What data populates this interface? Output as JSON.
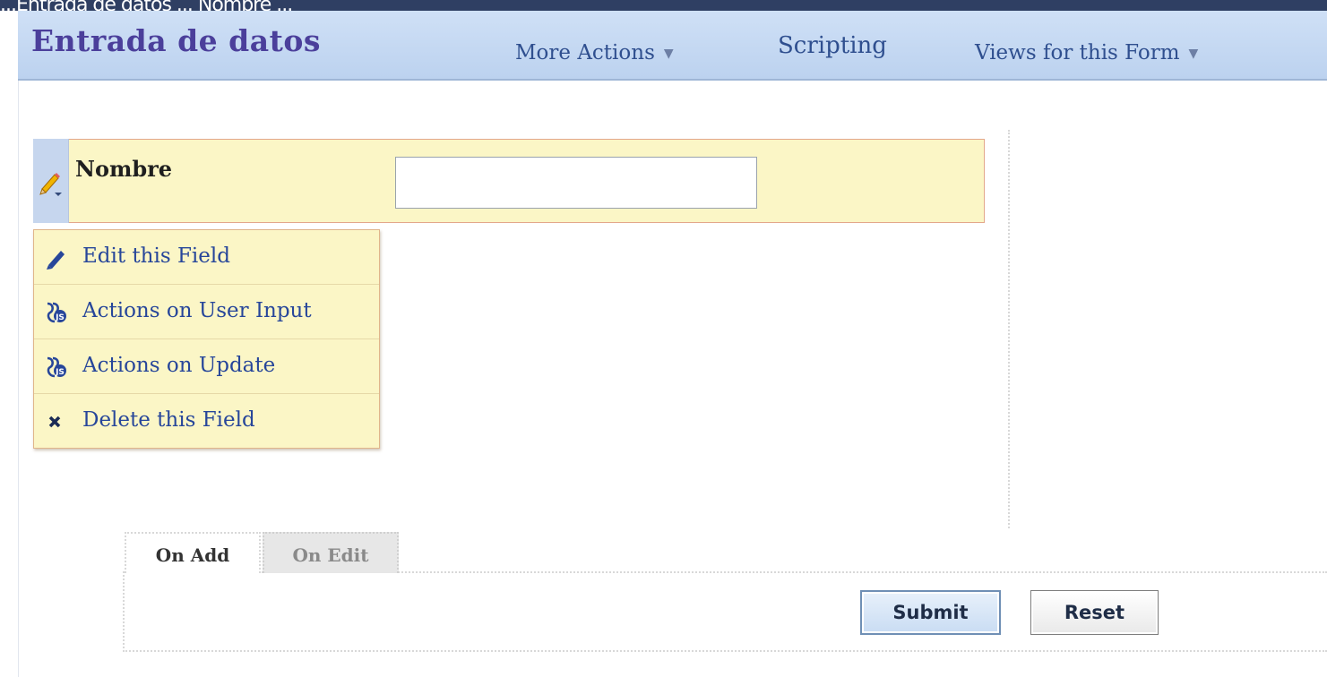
{
  "top_strip": {
    "text": "...Entrada de datos ... Nombre ..."
  },
  "header": {
    "title": "Entrada de datos",
    "menus": {
      "more_actions": "More Actions",
      "scripting": "Scripting",
      "views": "Views for this Form"
    }
  },
  "field": {
    "label": "Nombre",
    "value": ""
  },
  "context_menu": {
    "items": [
      {
        "label": "Edit this Field",
        "icon": "pencil-icon"
      },
      {
        "label": "Actions on User Input",
        "icon": "script-icon"
      },
      {
        "label": "Actions on Update",
        "icon": "script-icon"
      },
      {
        "label": "Delete this Field",
        "icon": "close-icon"
      }
    ]
  },
  "tabs": {
    "on_add": "On Add",
    "on_edit": "On Edit",
    "active": "On Add"
  },
  "buttons": {
    "submit": "Submit",
    "reset": "Reset"
  },
  "colors": {
    "header_bg": "#c4d7f1",
    "title": "#4b3f9b",
    "menu_text": "#2f4f8f",
    "field_bg": "#fbf6c6",
    "field_border": "#e3a78b",
    "link": "#27469a"
  }
}
